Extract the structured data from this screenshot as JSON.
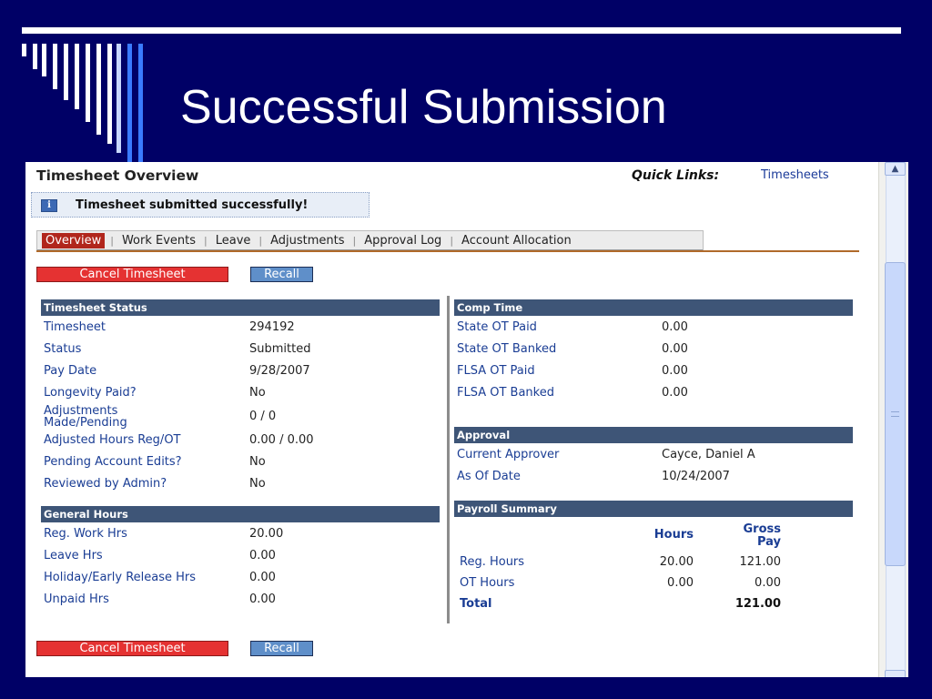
{
  "slide": {
    "title": "Successful Submission",
    "colors": {
      "background": "#000066",
      "rule": "#ffffff"
    }
  },
  "page": {
    "title": "Timesheet Overview",
    "quick_links_label": "Quick Links:",
    "quick_link": "Timesheets",
    "success_message": "Timesheet submitted successfully!",
    "info_icon": "info-icon"
  },
  "tabs": [
    {
      "label": "Overview",
      "active": true
    },
    {
      "label": "Work Events"
    },
    {
      "label": "Leave"
    },
    {
      "label": "Adjustments"
    },
    {
      "label": "Approval Log"
    },
    {
      "label": "Account Allocation"
    }
  ],
  "buttons": {
    "cancel": "Cancel Timesheet",
    "recall": "Recall"
  },
  "timesheet_status": {
    "heading": "Timesheet Status",
    "rows": [
      {
        "label": "Timesheet",
        "value": "294192"
      },
      {
        "label": "Status",
        "value": "Submitted"
      },
      {
        "label": "Pay Date",
        "value": "9/28/2007"
      },
      {
        "label": "Longevity Paid?",
        "value": "No"
      },
      {
        "label": "Adjustments Made/Pending",
        "value": "0 / 0"
      },
      {
        "label": "Adjusted Hours Reg/OT",
        "value": "0.00 / 0.00"
      },
      {
        "label": "Pending Account Edits?",
        "value": "No"
      },
      {
        "label": "Reviewed by Admin?",
        "value": "No"
      }
    ]
  },
  "general_hours": {
    "heading": "General Hours",
    "rows": [
      {
        "label": "Reg. Work Hrs",
        "value": "20.00"
      },
      {
        "label": "Leave Hrs",
        "value": "0.00"
      },
      {
        "label": "Holiday/Early Release Hrs",
        "value": "0.00"
      },
      {
        "label": "Unpaid Hrs",
        "value": "0.00"
      }
    ]
  },
  "comp_time": {
    "heading": "Comp Time",
    "rows": [
      {
        "label": "State OT Paid",
        "value": "0.00"
      },
      {
        "label": "State OT Banked",
        "value": "0.00"
      },
      {
        "label": "FLSA OT Paid",
        "value": "0.00"
      },
      {
        "label": "FLSA OT Banked",
        "value": "0.00"
      }
    ]
  },
  "approval": {
    "heading": "Approval",
    "rows": [
      {
        "label": "Current Approver",
        "value": "Cayce, Daniel A"
      },
      {
        "label": "As Of Date",
        "value": "10/24/2007"
      }
    ]
  },
  "payroll_summary": {
    "heading": "Payroll Summary",
    "col_hours": "Hours",
    "col_gross": "Gross Pay",
    "rows": [
      {
        "label": "Reg. Hours",
        "hours": "20.00",
        "gross": "121.00"
      },
      {
        "label": "OT Hours",
        "hours": "0.00",
        "gross": "0.00"
      }
    ],
    "total_label": "Total",
    "total_value": "121.00"
  }
}
